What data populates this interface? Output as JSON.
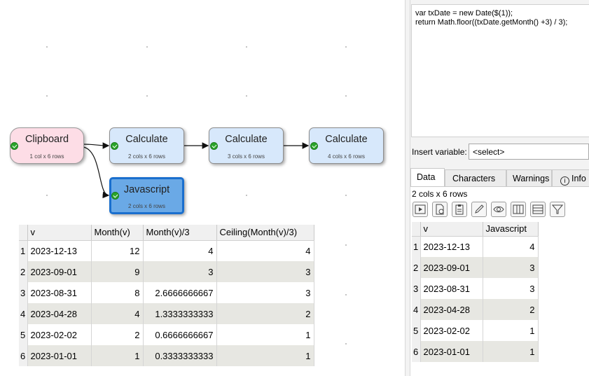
{
  "nodes": {
    "clipboard": {
      "title": "Clipboard",
      "sub": "1 col x 6 rows"
    },
    "calc1": {
      "title": "Calculate",
      "sub": "2 cols x 6 rows"
    },
    "calc2": {
      "title": "Calculate",
      "sub": "3 cols x 6 rows"
    },
    "calc3": {
      "title": "Calculate",
      "sub": "4 cols x 6 rows"
    },
    "javascript": {
      "title": "Javascript",
      "sub": "2 cols x 6 rows"
    }
  },
  "left_table": {
    "headers": [
      "v",
      "Month(v)",
      "Month(v)/3",
      "Ceiling(Month(v)/3)"
    ],
    "rows": [
      {
        "n": "1",
        "v": "2023-12-13",
        "m": "12",
        "m3": "4",
        "c": "4"
      },
      {
        "n": "2",
        "v": "2023-09-01",
        "m": "9",
        "m3": "3",
        "c": "3"
      },
      {
        "n": "3",
        "v": "2023-08-31",
        "m": "8",
        "m3": "2.6666666667",
        "c": "3"
      },
      {
        "n": "4",
        "v": "2023-04-28",
        "m": "4",
        "m3": "1.3333333333",
        "c": "2"
      },
      {
        "n": "5",
        "v": "2023-02-02",
        "m": "2",
        "m3": "0.6666666667",
        "c": "1"
      },
      {
        "n": "6",
        "v": "2023-01-01",
        "m": "1",
        "m3": "0.3333333333",
        "c": "1"
      }
    ]
  },
  "editor": {
    "line1": "var txDate = new Date($(1));",
    "line2": "return Math.floor((txDate.getMonth() +3) / 3);"
  },
  "insert_variable": {
    "label": "Insert variable:",
    "value": "<select>"
  },
  "tabs": {
    "data": "Data",
    "characters": "Characters",
    "warnings": "Warnings",
    "info": "Info"
  },
  "row_count": "2 cols x 6 rows",
  "right_table": {
    "headers": [
      "v",
      "Javascript"
    ],
    "rows": [
      {
        "n": "1",
        "v": "2023-12-13",
        "js": "4"
      },
      {
        "n": "2",
        "v": "2023-09-01",
        "js": "3"
      },
      {
        "n": "3",
        "v": "2023-08-31",
        "js": "3"
      },
      {
        "n": "4",
        "v": "2023-04-28",
        "js": "2"
      },
      {
        "n": "5",
        "v": "2023-02-02",
        "js": "1"
      },
      {
        "n": "6",
        "v": "2023-01-01",
        "js": "1"
      }
    ]
  },
  "icons": [
    "play-icon",
    "add-page-icon",
    "clipboard-icon",
    "pencil-icon",
    "eye-icon",
    "columns-icon",
    "rows-icon",
    "filter-icon",
    "info-icon",
    "check-icon"
  ]
}
